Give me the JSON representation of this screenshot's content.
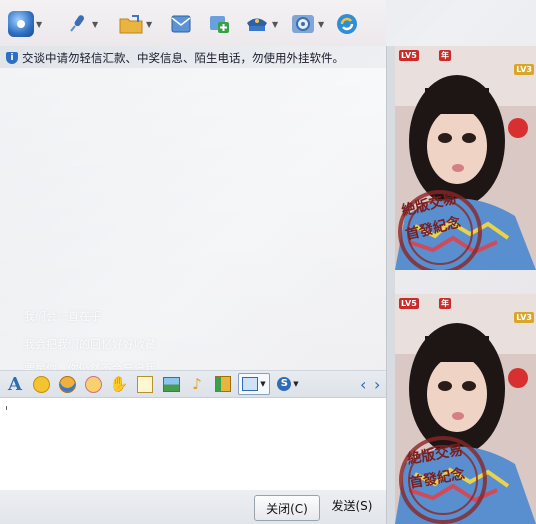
{
  "toolbar": {
    "items": [
      {
        "name": "video",
        "glyph": "●",
        "color": "#3a78c9",
        "has_menu": true
      },
      {
        "name": "voice",
        "glyph": "✎",
        "color": "#3a6fb8",
        "has_menu": true
      },
      {
        "name": "file",
        "glyph": "▭",
        "color": "#e0a630",
        "has_menu": true
      },
      {
        "name": "mail",
        "glyph": "✉",
        "color": "#4c86c8",
        "has_menu": false
      },
      {
        "name": "app",
        "glyph": "+",
        "color": "#3aa04a",
        "has_menu": false
      },
      {
        "name": "group",
        "glyph": "◆",
        "color": "#3d6fb5",
        "has_menu": true
      },
      {
        "name": "settings",
        "glyph": "⚙",
        "color": "#4f7fb6",
        "has_menu": true
      },
      {
        "name": "refresh",
        "glyph": "↻",
        "color": "#2e8fd8",
        "has_menu": false
      }
    ]
  },
  "notice": {
    "text": "交谈中请勿轻信汇款、中奖信息、陌生电话，勿使用外挂软件。"
  },
  "chat": {
    "ghost_lines": [
      "我们会一直在乎",
      "我会把我们的回忆好好收藏",
      "要是你...你仍然不会忘记我",
      "已经..."
    ]
  },
  "format_bar": {
    "items": [
      {
        "name": "font",
        "glyph": "A",
        "color": "#2e6db5"
      },
      {
        "name": "emoji",
        "glyph": "☺",
        "color": "#e0a020"
      },
      {
        "name": "magic-emoji",
        "glyph": "☻",
        "color": "#e08a20"
      },
      {
        "name": "doodle",
        "glyph": "✿",
        "color": "#d9687a"
      },
      {
        "name": "vibrate",
        "glyph": "✋",
        "color": "#e0a020"
      },
      {
        "name": "note",
        "glyph": "✎",
        "color": "#d0a030"
      },
      {
        "name": "image",
        "glyph": "▦",
        "color": "#3d8a4a"
      },
      {
        "name": "music",
        "glyph": "♪",
        "color": "#e0a020"
      },
      {
        "name": "gift",
        "glyph": "✚",
        "color": "#3aa04a"
      },
      {
        "name": "screenshot",
        "glyph": "▣",
        "color": "#2e6db5"
      },
      {
        "name": "sogou",
        "glyph": "S",
        "color": "#2e6db5"
      }
    ],
    "nav_prev": "‹",
    "nav_next": "›"
  },
  "buttons": {
    "close": "关闭(C)",
    "send": "发送(S)"
  },
  "profile": {
    "level_badge": "LV5",
    "year_badge": "年",
    "corner_badge": "LV3",
    "stamp_line1": "絶版交易",
    "stamp_line2": "首發紀念"
  }
}
